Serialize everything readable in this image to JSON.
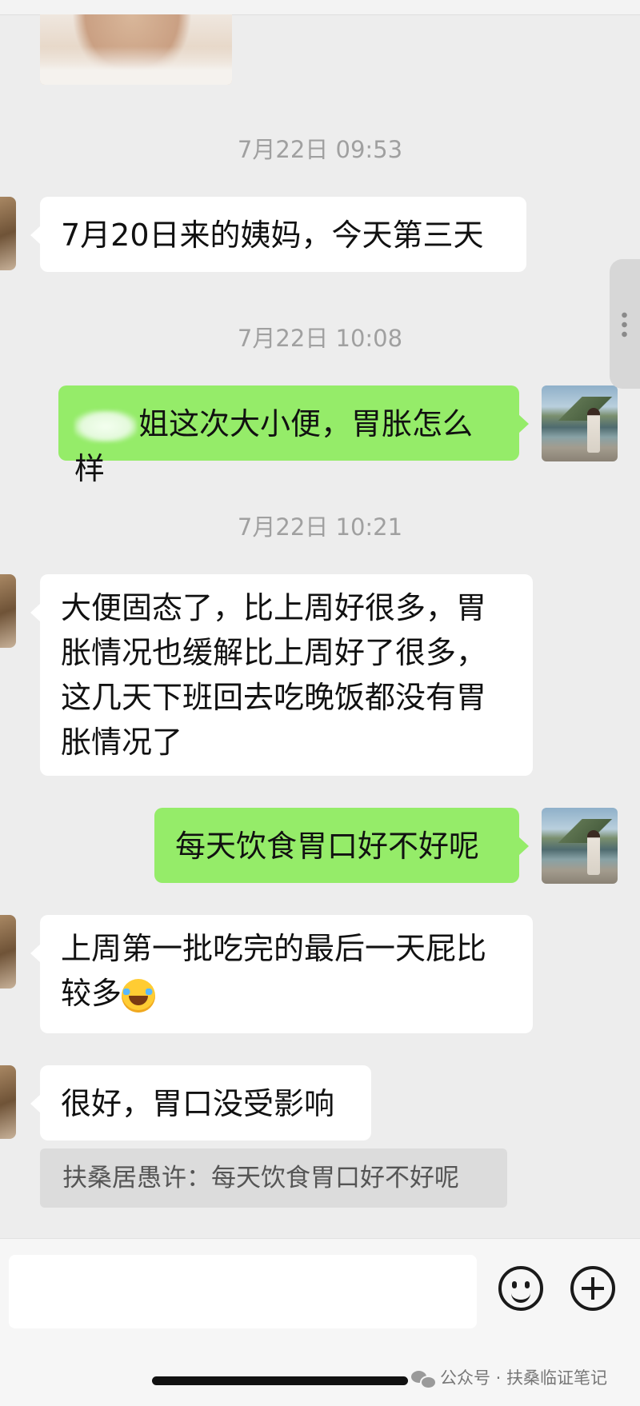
{
  "messages": {
    "time1": "7月22日 09:53",
    "msg1": "7月20日来的姨妈，今天第三天",
    "time2": "7月22日 10:08",
    "msg2": "姐这次大小便，胃胀怎么样",
    "time3": "7月22日 10:21",
    "msg3": "大便固态了，比上周好很多，胃胀情况也缓解比上周好了很多，这几天下班回去吃晚饭都没有胃胀情况了",
    "msg4": "每天饮食胃口好不好呢",
    "msg5": "上周第一批吃完的最后一天屁比较多",
    "msg5_emoji": "tears-of-joy-emoji",
    "msg6": "很好，胃口没受影响",
    "quote": "扶桑居愚许：每天饮食胃口好不好呢"
  },
  "watermark": {
    "text": "公众号 · 扶桑临证笔记"
  },
  "composer": {
    "input_value": "",
    "emoji_button": "emoji-icon",
    "plus_button": "plus-icon"
  },
  "colors": {
    "background": "#ededed",
    "sent_bubble": "#95ec69",
    "received_bubble": "#ffffff"
  }
}
